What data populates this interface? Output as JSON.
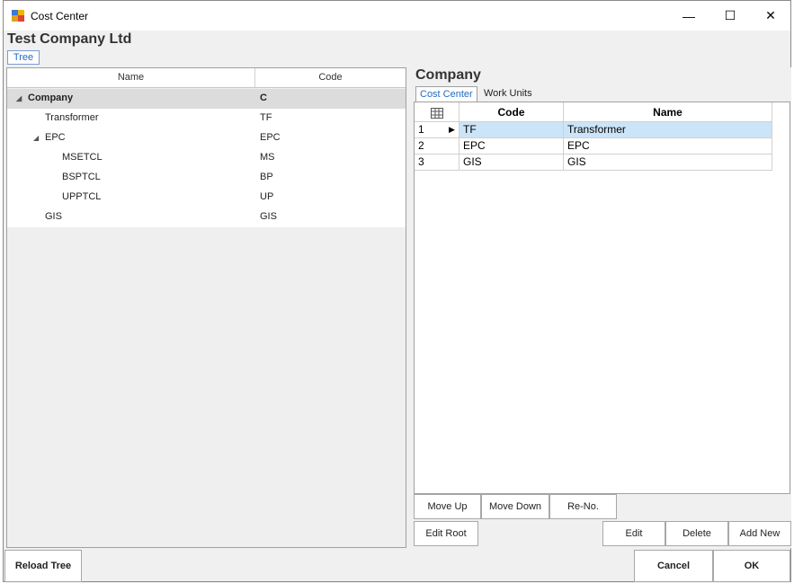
{
  "window": {
    "title": "Cost Center",
    "minimize_glyph": "—",
    "maximize_glyph": "☐",
    "close_glyph": "✕"
  },
  "company": "Test Company Ltd",
  "tree_tab": "Tree",
  "tree": {
    "columns": [
      "Name",
      "Code"
    ],
    "rows": [
      {
        "name": "Company",
        "code": "C",
        "toggle": "◢"
      },
      {
        "name": "Transformer",
        "code": "TF",
        "toggle": ""
      },
      {
        "name": "EPC",
        "code": "EPC",
        "toggle": "◢"
      },
      {
        "name": "MSETCL",
        "code": "MS",
        "toggle": ""
      },
      {
        "name": "BSPTCL",
        "code": "BP",
        "toggle": ""
      },
      {
        "name": "UPPTCL",
        "code": "UP",
        "toggle": ""
      },
      {
        "name": "GIS",
        "code": "GIS",
        "toggle": ""
      }
    ]
  },
  "right": {
    "title": "Company",
    "tabs": [
      "Cost Center",
      "Work Units"
    ],
    "grid": {
      "columns": [
        "Code",
        "Name"
      ],
      "rows": [
        {
          "num": "1",
          "code": "TF",
          "name": "Transformer"
        },
        {
          "num": "2",
          "code": "EPC",
          "name": "EPC"
        },
        {
          "num": "3",
          "code": "GIS",
          "name": "GIS"
        }
      ]
    },
    "buttons": {
      "move_up": "Move Up",
      "move_down": "Move Down",
      "reno": "Re-No.",
      "edit_root": "Edit Root",
      "edit": "Edit",
      "delete": "Delete",
      "add_new": "Add New"
    }
  },
  "footer": {
    "reload": "Reload Tree",
    "cancel": "Cancel",
    "ok": "OK"
  },
  "colors": {
    "selected_row": "#cce4f7",
    "tab_active_text": "#1e6cc8"
  }
}
